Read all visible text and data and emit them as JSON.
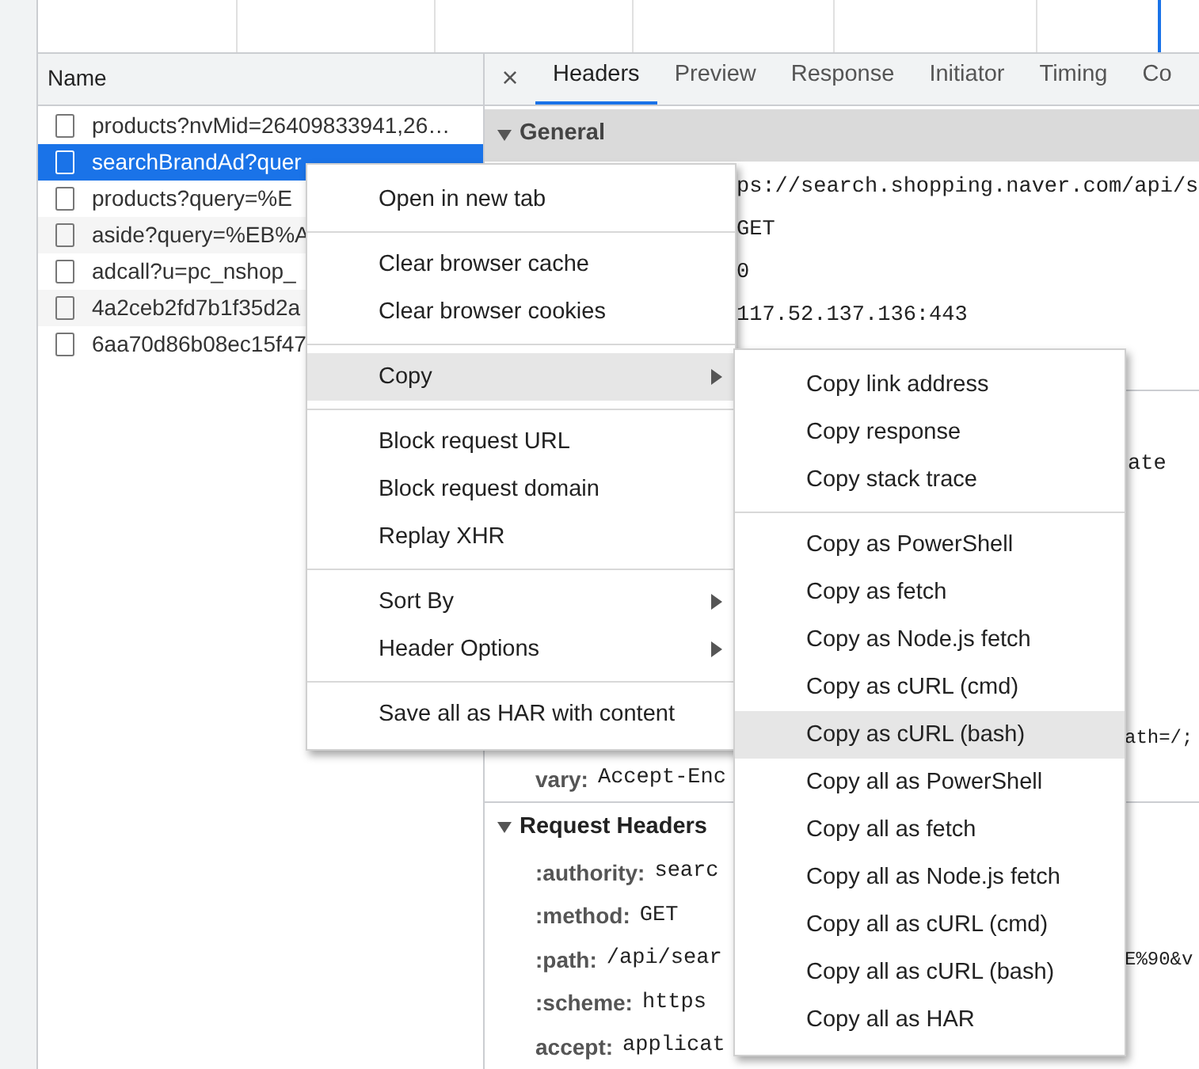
{
  "name_panel": {
    "header": "Name",
    "requests": [
      {
        "name": "products?nvMid=26409833941,26…",
        "selected": false
      },
      {
        "name": "searchBrandAd?quer",
        "selected": true
      },
      {
        "name": "products?query=%E",
        "selected": false
      },
      {
        "name": "aside?query=%EB%A",
        "selected": false
      },
      {
        "name": "adcall?u=pc_nshop_",
        "selected": false
      },
      {
        "name": "4a2ceb2fd7b1f35d2a",
        "selected": false
      },
      {
        "name": "6aa70d86b08ec15f47",
        "selected": false
      }
    ]
  },
  "detail": {
    "close": "×",
    "tabs": [
      {
        "label": "Headers",
        "selected": true
      },
      {
        "label": "Preview",
        "selected": false
      },
      {
        "label": "Response",
        "selected": false
      },
      {
        "label": "Initiator",
        "selected": false
      },
      {
        "label": "Timing",
        "selected": false
      },
      {
        "label": "Co",
        "selected": false
      }
    ],
    "general": {
      "title": "General",
      "values": [
        "ps://search.shopping.naver.com/api/s",
        "GET",
        "0",
        "117.52.137.136:443"
      ]
    },
    "response_headers": {
      "fragments": [
        "ate",
        "ath=/;"
      ],
      "last_row": {
        "key": "vary:",
        "value": "Accept-Enc"
      }
    },
    "request_headers": {
      "title": "Request Headers",
      "rows": [
        {
          "key": ":authority:",
          "value": "searc",
          "tail": ""
        },
        {
          "key": ":method:",
          "value": "GET",
          "tail": ""
        },
        {
          "key": ":path:",
          "value": "/api/sear",
          "tail": "E%90&v"
        },
        {
          "key": ":scheme:",
          "value": "https",
          "tail": ""
        },
        {
          "key": "accept:",
          "value": "applicat",
          "tail": ""
        }
      ]
    }
  },
  "context_menu": {
    "groups": [
      [
        {
          "label": "Open in new tab",
          "submenu": false,
          "selected": false
        }
      ],
      [
        {
          "label": "Clear browser cache",
          "submenu": false,
          "selected": false
        },
        {
          "label": "Clear browser cookies",
          "submenu": false,
          "selected": false
        }
      ],
      [
        {
          "label": "Copy",
          "submenu": true,
          "selected": true
        }
      ],
      [
        {
          "label": "Block request URL",
          "submenu": false,
          "selected": false
        },
        {
          "label": "Block request domain",
          "submenu": false,
          "selected": false
        },
        {
          "label": "Replay XHR",
          "submenu": false,
          "selected": false
        }
      ],
      [
        {
          "label": "Sort By",
          "submenu": true,
          "selected": false
        },
        {
          "label": "Header Options",
          "submenu": true,
          "selected": false
        }
      ],
      [
        {
          "label": "Save all as HAR with content",
          "submenu": false,
          "selected": false
        }
      ]
    ]
  },
  "copy_submenu": {
    "groups": [
      [
        {
          "label": "Copy link address",
          "selected": false
        },
        {
          "label": "Copy response",
          "selected": false
        },
        {
          "label": "Copy stack trace",
          "selected": false
        }
      ],
      [
        {
          "label": "Copy as PowerShell",
          "selected": false
        },
        {
          "label": "Copy as fetch",
          "selected": false
        },
        {
          "label": "Copy as Node.js fetch",
          "selected": false
        },
        {
          "label": "Copy as cURL (cmd)",
          "selected": false
        },
        {
          "label": "Copy as cURL (bash)",
          "selected": true
        },
        {
          "label": "Copy all as PowerShell",
          "selected": false
        },
        {
          "label": "Copy all as fetch",
          "selected": false
        },
        {
          "label": "Copy all as Node.js fetch",
          "selected": false
        },
        {
          "label": "Copy all as cURL (cmd)",
          "selected": false
        },
        {
          "label": "Copy all as cURL (bash)",
          "selected": false
        },
        {
          "label": "Copy all as HAR",
          "selected": false
        }
      ]
    ]
  }
}
